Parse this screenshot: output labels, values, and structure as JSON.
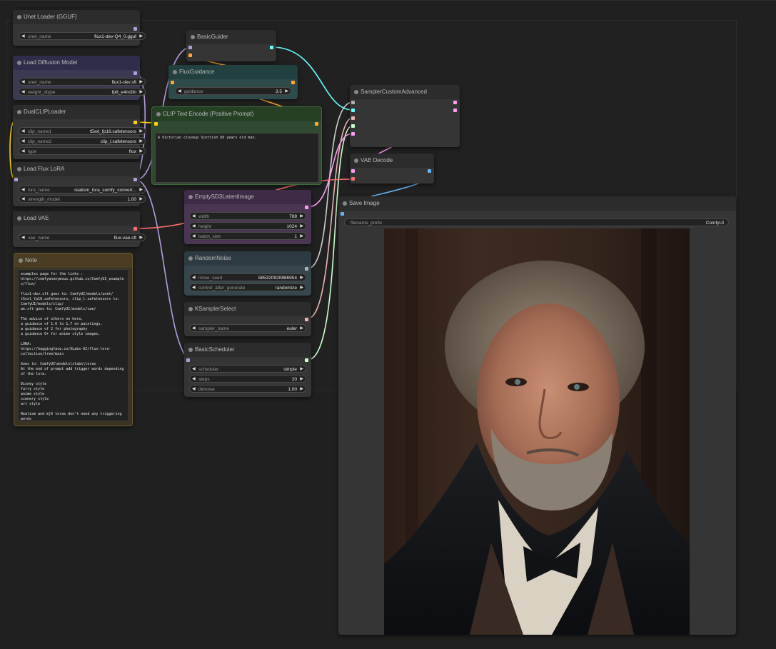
{
  "colors": {
    "model": "#b39ddb",
    "clip": "#ffd500",
    "conditioning": "#ffa931",
    "latent": "#ff9cf9",
    "vae": "#ff6e6e",
    "image": "#64b5f6",
    "noise": "#b0b0b0",
    "guider": "#66ffff",
    "sampler": "#ecb4b4",
    "sigmas": "#cdffcd"
  },
  "nodes": {
    "unet_loader": {
      "title": "Unet Loader (GGUF)",
      "w_unet_name_label": "unet_name",
      "w_unet_name_value": "flux1-dev-Q4_0.gguf"
    },
    "load_diffusion": {
      "title": "Load Diffusion Model",
      "w_unet_name_label": "unet_name",
      "w_unet_name_value": "flux1-dev.sft",
      "w_weight_label": "weight_dtype",
      "w_weight_value": "fp8_e4m3fn"
    },
    "dual_clip": {
      "title": "DualCLIPLoader",
      "w_clip1_label": "clip_name1",
      "w_clip1_value": "t5xxl_fp16.safetensors",
      "w_clip2_label": "clip_name2",
      "w_clip2_value": "clip_l.safetensors",
      "w_type_label": "type",
      "w_type_value": "flux"
    },
    "flux_lora": {
      "title": "Load Flux LoRA",
      "w_lora_label": "lora_name",
      "w_lora_value": "realism_lora_comfy_convert...",
      "w_strength_label": "strength_model",
      "w_strength_value": "1.00"
    },
    "load_vae": {
      "title": "Load VAE",
      "w_vae_label": "vae_name",
      "w_vae_value": "flux-vae.sft"
    },
    "note": {
      "title": "Note",
      "text": "examples page for the links :\nhttps://comfyanonymous.github.io/ComfyUI_example\ns/flux/\n\nflux1-dev.sft goes to: ComfyUI/models/unet/\nt5xxl_fp16.safetensors, clip_l.safetensors to:\nComfyUI/models/clip/\nae.sft goes to: ComfyUI/models/vae/\n\nThe advice of others on here,\na guidance of 1.6 to 1.7 on paintings,\na guidance of 2 for photography\na guidance 6+ for anime style images.\n\nLORA:\nhttps://huggingface.co/XLabs-AI/flux-lora-\ncollection/tree/main\n\nGoes to: ComfyUI\\models\\xlabs\\loras\nAt the end of prompt add trigger words depending\nof the lora.\n\nDisney style\nfurry style\nanime style\nscenery style\nart style\n\nRealism and mj6 loras don't need any triggering\nwords"
    },
    "basic_guider": {
      "title": "BasicGuider"
    },
    "flux_guidance": {
      "title": "FluxGuidance",
      "w_guidance_label": "guidance",
      "w_guidance_value": "3.5"
    },
    "clip_text": {
      "title": "CLIP Text Encode (Positive Prompt)",
      "prompt": "A Victorian closeup Scottish 60 years old man."
    },
    "empty_latent": {
      "title": "EmptySD3LatentImage",
      "w_width_label": "width",
      "w_width_value": "768",
      "w_height_label": "height",
      "w_height_value": "1024",
      "w_batch_label": "batch_size",
      "w_batch_value": "1"
    },
    "random_noise": {
      "title": "RandomNoise",
      "w_seed_label": "noise_seed",
      "w_seed_value": "585320920886954",
      "w_control_label": "control_after_generate",
      "w_control_value": "randomize"
    },
    "ksampler_select": {
      "title": "KSamplerSelect",
      "w_sampler_label": "sampler_name",
      "w_sampler_value": "euler"
    },
    "basic_scheduler": {
      "title": "BasicScheduler",
      "w_scheduler_label": "scheduler",
      "w_scheduler_value": "simple",
      "w_steps_label": "steps",
      "w_steps_value": "20",
      "w_denoise_label": "denoise",
      "w_denoise_value": "1.00"
    },
    "sampler_custom": {
      "title": "SamplerCustomAdvanced"
    },
    "vae_decode": {
      "title": "VAE Decode"
    },
    "save_image": {
      "title": "Save Image",
      "w_prefix_label": "filename_prefix",
      "w_prefix_value": "ComfyUI"
    }
  }
}
